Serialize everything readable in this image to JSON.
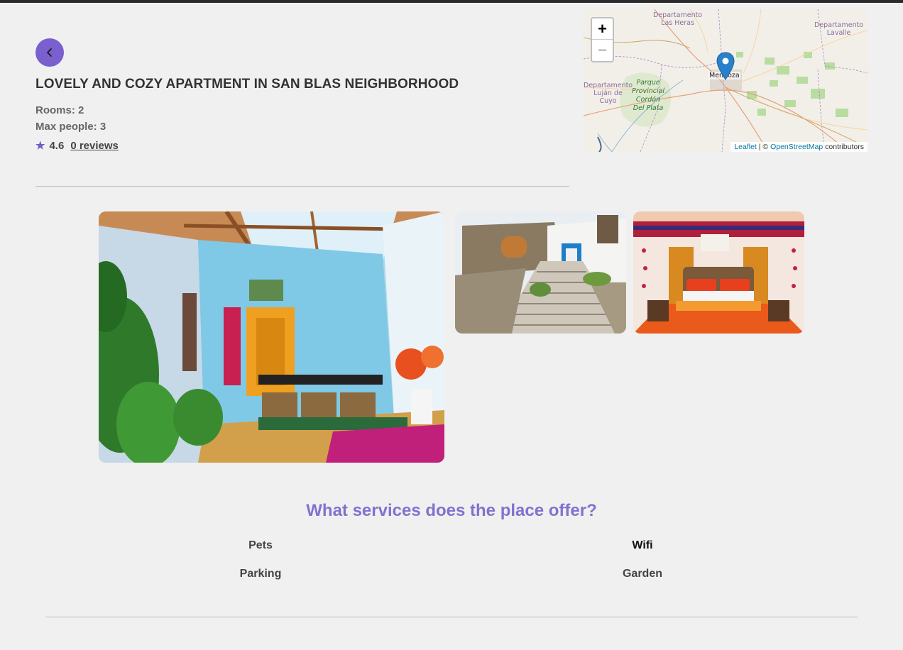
{
  "listing": {
    "title": "LOVELY AND COZY APARTMENT IN SAN BLAS NEIGHBORHOOD",
    "rooms": "Rooms: 2",
    "max_people": "Max people: 3",
    "rating": "4.6",
    "reviews": "0 reviews"
  },
  "map": {
    "zoom_in": "+",
    "zoom_out": "−",
    "labels": {
      "las_heras": "Departamento\nLas Heras",
      "lavalle": "Departamento\nLavalle",
      "lujan": "Departamento\nLuján de\nCuyo",
      "park": "Parque\nProvincial\nCordón\nDel Plata",
      "city": "Mendoza"
    },
    "attribution": {
      "leaflet": "Leaflet",
      "separator": " | © ",
      "osm": "OpenStreetMap",
      "suffix": " contributors"
    }
  },
  "services": {
    "title": "What services does the place offer?",
    "items": [
      "Pets",
      "Wifi",
      "Parking",
      "Garden"
    ]
  },
  "colors": {
    "accent": "#7a5fcf",
    "heading": "#8272cf",
    "marker": "#2a81cb"
  },
  "icons": {
    "back": "chevron-left-icon",
    "rating": "star-icon",
    "marker": "map-pin-icon"
  }
}
